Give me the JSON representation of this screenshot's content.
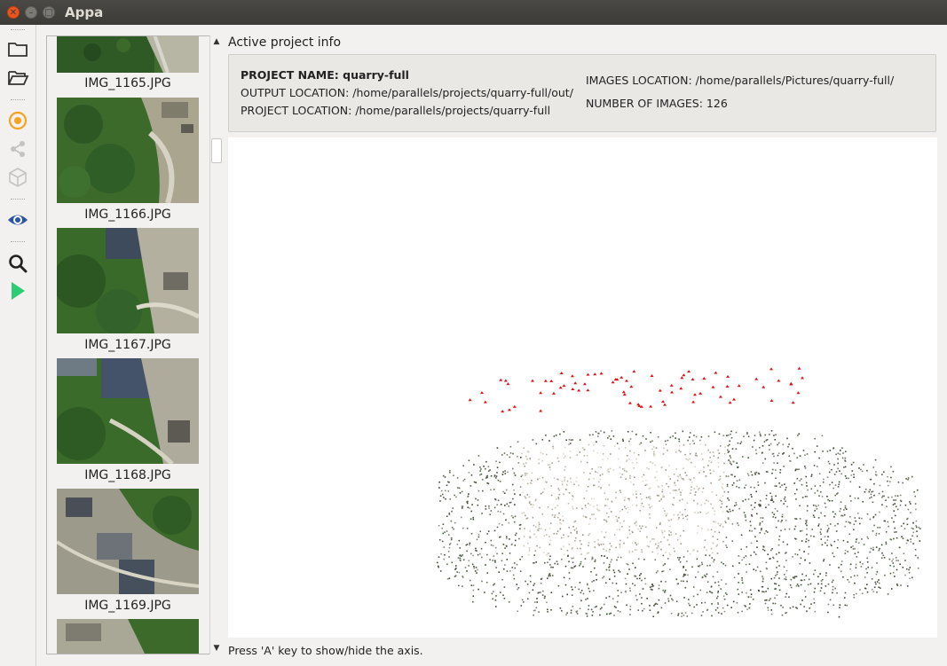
{
  "window": {
    "title": "Appa"
  },
  "toolbar": {
    "items": [
      {
        "icon": "folder-new-icon"
      },
      {
        "icon": "folder-open-icon"
      },
      {
        "icon": "target-icon"
      },
      {
        "icon": "share-icon"
      },
      {
        "icon": "cube-icon"
      },
      {
        "icon": "eye-icon"
      },
      {
        "icon": "search-icon"
      },
      {
        "icon": "play-icon"
      }
    ],
    "accent_orange": "#f6a21d",
    "accent_blue": "#2c55a8",
    "accent_green": "#2ecc71"
  },
  "image_list": {
    "items": [
      {
        "label": "IMG_1165.JPG"
      },
      {
        "label": "IMG_1166.JPG"
      },
      {
        "label": "IMG_1167.JPG"
      },
      {
        "label": "IMG_1168.JPG"
      },
      {
        "label": "IMG_1169.JPG"
      }
    ]
  },
  "info": {
    "section_title": "Active project info",
    "project_name_label": "PROJECT NAME: quarry-full",
    "output_location": "OUTPUT LOCATION: /home/parallels/projects/quarry-full/out/",
    "project_location": "PROJECT LOCATION: /home/parallels/projects/quarry-full",
    "images_location": "IMAGES LOCATION: /home/parallels/Pictures/quarry-full/",
    "number_of_images": "NUMBER OF IMAGES: 126"
  },
  "status": {
    "hint": "Press 'A' key to show/hide the axis."
  }
}
